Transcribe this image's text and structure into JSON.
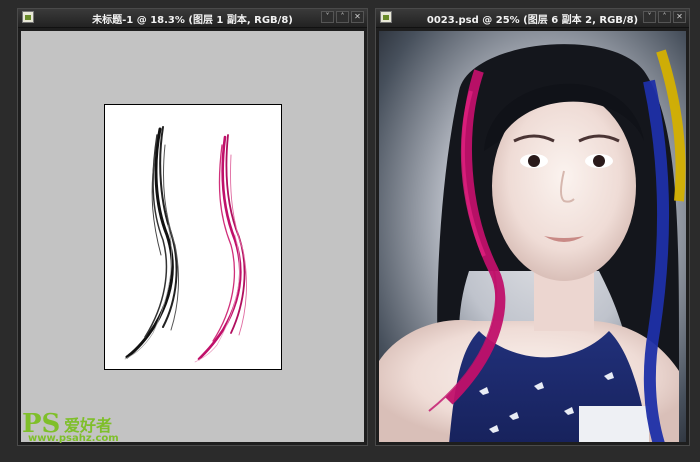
{
  "left_window": {
    "title": "未标题-1 @ 18.3% (图层 1 副本, RGB/8)",
    "controls": [
      "˅",
      "˄",
      "✕"
    ]
  },
  "right_window": {
    "title": "0023.psd @ 25% (图层 6 副本 2, RGB/8)",
    "controls": [
      "˅",
      "˄",
      "✕"
    ]
  },
  "watermark": {
    "brand": "PS",
    "chinese": "爱好者",
    "url": "www.psahz.com"
  },
  "colors": {
    "hair_black": "#111111",
    "hair_magenta": "#c0106a",
    "hair_blue": "#1d2fa8",
    "hair_yellow": "#d4b000",
    "watermark_green": "#7fbf2a"
  }
}
